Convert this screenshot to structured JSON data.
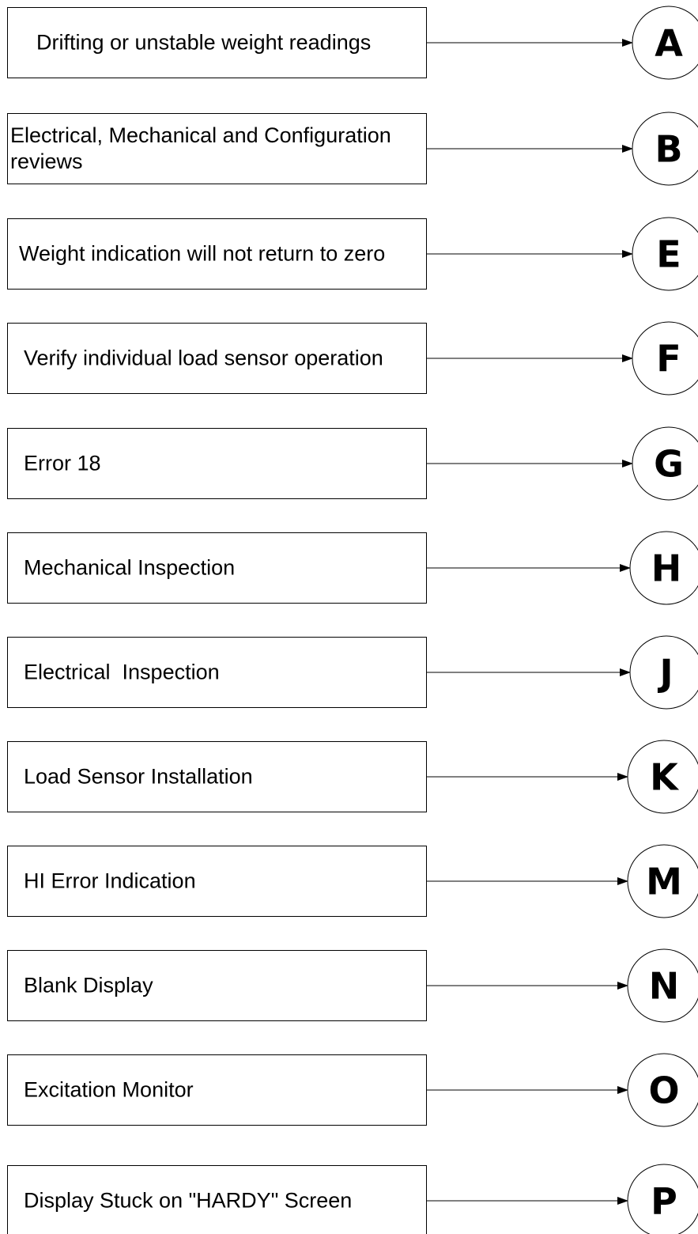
{
  "rows": [
    {
      "lines": [
        "Drifting or unstable weight readings"
      ],
      "letter": "A"
    },
    {
      "lines": [
        "Electrical, Mechanical and Configuration",
        "reviews"
      ],
      "letter": "B"
    },
    {
      "lines": [
        "Weight indication will not return to zero"
      ],
      "letter": "E"
    },
    {
      "lines": [
        "Verify individual load sensor operation"
      ],
      "letter": "F"
    },
    {
      "lines": [
        "Error 18"
      ],
      "letter": "G"
    },
    {
      "lines": [
        "Mechanical Inspection"
      ],
      "letter": "H"
    },
    {
      "lines": [
        "Electrical  Inspection"
      ],
      "letter": "J"
    },
    {
      "lines": [
        "Load Sensor Installation"
      ],
      "letter": "K"
    },
    {
      "lines": [
        "HI Error Indication"
      ],
      "letter": "M"
    },
    {
      "lines": [
        "Blank Display"
      ],
      "letter": "N"
    },
    {
      "lines": [
        "Excitation Monitor"
      ],
      "letter": "O"
    },
    {
      "lines": [
        "Display Stuck on \"HARDY\" Screen"
      ],
      "letter": "P"
    }
  ]
}
